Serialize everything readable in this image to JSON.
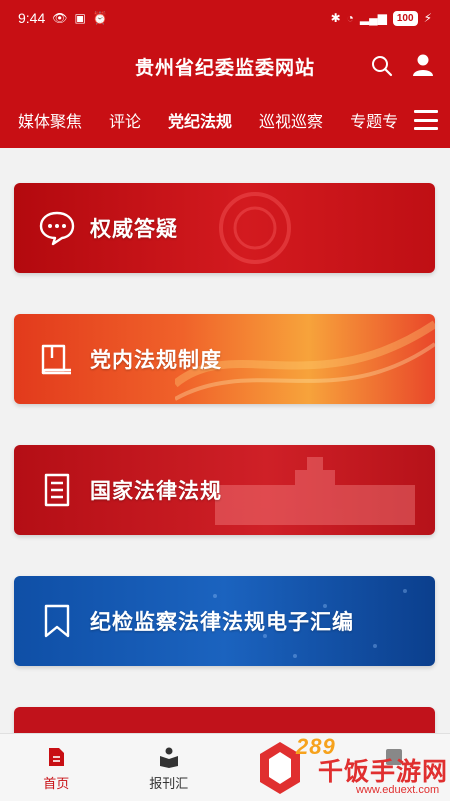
{
  "status_bar": {
    "time": "9:44",
    "battery": "100"
  },
  "header": {
    "title": "贵州省纪委监委网站",
    "search_icon": "search-icon",
    "user_icon": "user-icon"
  },
  "nav": {
    "items": [
      {
        "label": "媒体聚焦"
      },
      {
        "label": "评论"
      },
      {
        "label": "党纪法规"
      },
      {
        "label": "巡视巡察"
      },
      {
        "label": "专题专"
      }
    ],
    "active_index": 2,
    "menu_icon": "menu-icon"
  },
  "cards": [
    {
      "label": "权威答疑",
      "icon": "chat-bubble-icon"
    },
    {
      "label": "党内法规制度",
      "icon": "book-icon"
    },
    {
      "label": "国家法律法规",
      "icon": "document-icon"
    },
    {
      "label": "纪检监察法律法规电子汇编",
      "icon": "bookmark-icon"
    }
  ],
  "bottom_tabs": [
    {
      "label": "首页",
      "icon": "home-doc-icon",
      "active": true
    },
    {
      "label": "报刊汇",
      "icon": "reader-icon",
      "active": false
    },
    {
      "label": "",
      "icon": "tab-icon",
      "active": false
    },
    {
      "label": "",
      "icon": "tab-icon",
      "active": false
    }
  ],
  "watermark": {
    "number": "289",
    "text": "千饭手游网",
    "url": "www.eduext.com"
  },
  "colors": {
    "brand_red": "#c80f14",
    "card_blue": "#1b63bf",
    "card_orange": "#f0622a"
  }
}
